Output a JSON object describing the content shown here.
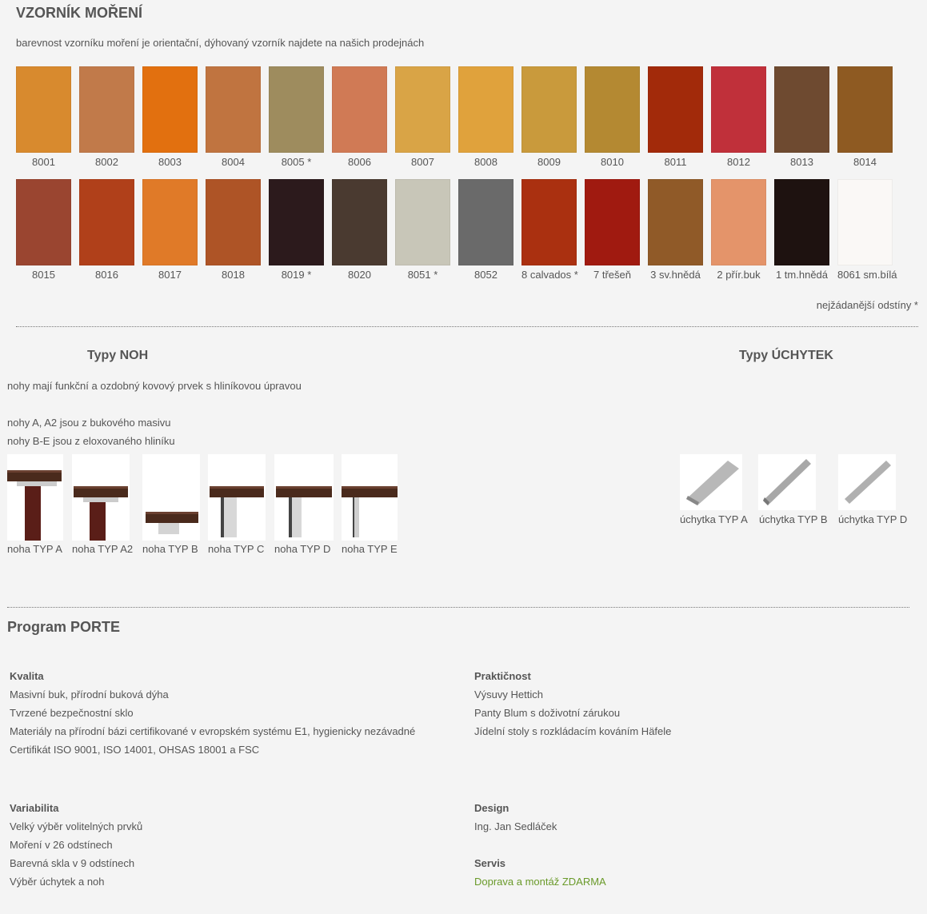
{
  "stain": {
    "title": "VZORNÍK MOŘENÍ",
    "note": "barevnost vzorníku moření je orientační, dýhovaný vzorník najdete na našich prodejnách",
    "row1": [
      {
        "code": "8001",
        "color": "#d88a2e"
      },
      {
        "code": "8002",
        "color": "#c17a4a"
      },
      {
        "code": "8003",
        "color": "#e2700f"
      },
      {
        "code": "8004",
        "color": "#c07440"
      },
      {
        "code": "8005 *",
        "color": "#9e8c5e"
      },
      {
        "code": "8006",
        "color": "#d07a55"
      },
      {
        "code": "8007",
        "color": "#d9a446"
      },
      {
        "code": "8008",
        "color": "#e0a23c"
      },
      {
        "code": "8009",
        "color": "#c99a3c"
      },
      {
        "code": "8010",
        "color": "#b48932"
      },
      {
        "code": "8011",
        "color": "#a22a0a"
      },
      {
        "code": "8012",
        "color": "#c0303a"
      },
      {
        "code": "8013",
        "color": "#6e4a30"
      },
      {
        "code": "8014",
        "color": "#8e5a22"
      }
    ],
    "row2": [
      {
        "code": "8015",
        "color": "#9a4530"
      },
      {
        "code": "8016",
        "color": "#b0401a"
      },
      {
        "code": "8017",
        "color": "#e07a28"
      },
      {
        "code": "8018",
        "color": "#ae5426"
      },
      {
        "code": "8019 *",
        "color": "#2c1a1c"
      },
      {
        "code": "8020",
        "color": "#4a3a30"
      },
      {
        "code": "8051 *",
        "color": "#c8c6b8"
      },
      {
        "code": "8052",
        "color": "#6a6a6a"
      },
      {
        "code": "8 calvados *",
        "color": "#aa3010"
      },
      {
        "code": "7 třešeň",
        "color": "#a01a10"
      },
      {
        "code": "3 sv.hnědá",
        "color": "#905a28"
      },
      {
        "code": "2 přír.buk",
        "color": "#e4946a"
      },
      {
        "code": "1 tm.hnědá",
        "color": "#1e1210"
      },
      {
        "code": "8061 sm.bílá",
        "color": "#faf8f6"
      }
    ],
    "popular": "nejžádanější odstíny *"
  },
  "legs": {
    "title": "Typy NOH",
    "desc1": "nohy mají funkční a ozdobný kovový prvek s hliníkovou úpravou",
    "desc2": "nohy A, A2 jsou z bukového masivu",
    "desc3": "nohy B-E jsou z eloxovaného hliníku",
    "items": [
      {
        "label": "noha TYP A"
      },
      {
        "label": "noha TYP A2"
      },
      {
        "label": "noha TYP B"
      },
      {
        "label": "noha TYP C"
      },
      {
        "label": "noha TYP D"
      },
      {
        "label": "noha TYP E"
      }
    ]
  },
  "handles": {
    "title": "Typy ÚCHYTEK",
    "items": [
      {
        "label": "úchytka TYP A"
      },
      {
        "label": "úchytka TYP B"
      },
      {
        "label": "úchytka TYP D"
      }
    ]
  },
  "program": {
    "title": "Program PORTE",
    "quality": {
      "head": "Kvalita",
      "lines": [
        "Masivní buk, přírodní buková dýha",
        "Tvrzené bezpečnostní sklo",
        "Materiály na přírodní bázi certifikované v evropském systému E1, hygienicky nezávadné",
        "Certifikát ISO 9001, ISO 14001, OHSAS 18001 a FSC"
      ]
    },
    "practical": {
      "head": "Praktičnost",
      "lines": [
        "Výsuvy Hettich",
        "Panty Blum s doživotní zárukou",
        "Jídelní stoly s rozkládacím kováním Häfele"
      ]
    },
    "variability": {
      "head": "Variabilita",
      "lines": [
        "Velký výběr volitelných prvků",
        "Moření v 26 odstínech",
        "Barevná skla v 9 odstínech",
        "Výběr úchytek a noh"
      ]
    },
    "design": {
      "head": "Design",
      "lines": [
        "Ing. Jan Sedláček"
      ]
    },
    "service": {
      "head": "Servis",
      "link": "Doprava a montáž ZDARMA"
    }
  }
}
